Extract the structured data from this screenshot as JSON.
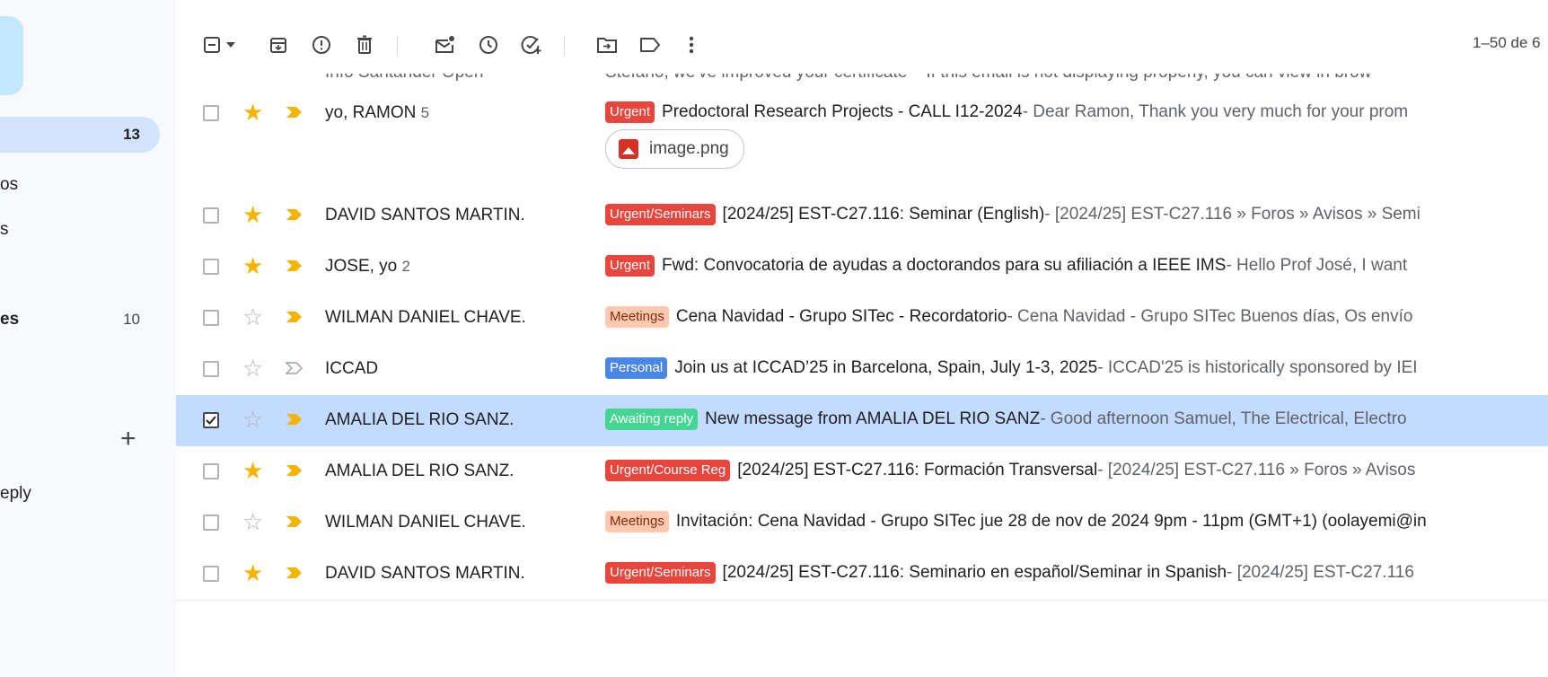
{
  "sidebar": {
    "items": [
      {
        "label": "",
        "count": "13"
      },
      {
        "label": "os",
        "count": ""
      },
      {
        "label": "s",
        "count": ""
      },
      {
        "label": "es",
        "count": "10"
      },
      {
        "label": "eply",
        "count": ""
      }
    ],
    "add_icon": "plus-icon"
  },
  "toolbar": {
    "icons": [
      "select-checkbox-icon",
      "dropdown-arrow-icon",
      "archive-icon",
      "report-spam-icon",
      "delete-icon",
      "mark-unread-icon",
      "snooze-icon",
      "add-task-icon",
      "move-to-icon",
      "label-icon",
      "more-vert-icon"
    ],
    "pager": "1–50 de 6"
  },
  "partial_row": {
    "sender": "Info Santander Open",
    "line": "Stefano, we've improved your certificate – If this email is not displaying properly, you can view in brow"
  },
  "rows": [
    {
      "sender": "yo, RAMON",
      "count": "5",
      "starred": true,
      "important": true,
      "selected": false,
      "label": "Urgent",
      "label_color": "#e8453c",
      "subject": "Predoctoral Research Projects - CALL I12-2024",
      "snippet": " - Dear Ramon, Thank you very much for your prom",
      "attachment": "image.png"
    },
    {
      "sender": "DAVID SANTOS MARTIN.",
      "count": "",
      "starred": true,
      "important": true,
      "selected": false,
      "label": "Urgent/Seminars",
      "label_color": "#e8453c",
      "subject": "[2024/25] EST-C27.116: Seminar (English)",
      "snippet": " - [2024/25] EST-C27.116 » Foros » Avisos » Semi"
    },
    {
      "sender": "JOSE, yo",
      "count": "2",
      "starred": true,
      "important": true,
      "selected": false,
      "label": "Urgent",
      "label_color": "#e8453c",
      "subject": "Fwd: Convocatoria de ayudas a doctorandos para su afiliación a IEEE IMS",
      "snippet": " - Hello Prof José, I want"
    },
    {
      "sender": "WILMAN DANIEL CHAVE.",
      "count": "",
      "starred": false,
      "important": true,
      "selected": false,
      "label": "Meetings",
      "label_color": "#ffc8af",
      "subject": "Cena Navidad - Grupo SITec - Recordatorio",
      "snippet": " - Cena Navidad - Grupo SITec Buenos días, Os envío"
    },
    {
      "sender": "ICCAD",
      "count": "",
      "starred": false,
      "important": false,
      "selected": false,
      "label": "Personal",
      "label_color": "#4a86e8",
      "subject": "Join us at ICCAD’25 in Barcelona, Spain, July 1-3, 2025",
      "snippet": " - ICCAD'25 is historically sponsored by IEI"
    },
    {
      "sender": "AMALIA DEL RIO SANZ.",
      "count": "",
      "starred": false,
      "important": true,
      "selected": true,
      "label": "Awaiting reply",
      "label_color": "#43d692",
      "subject": "New message from AMALIA DEL RIO SANZ",
      "snippet": " - Good afternoon Samuel, The Electrical, Electro"
    },
    {
      "sender": "AMALIA DEL RIO SANZ.",
      "count": "",
      "starred": true,
      "important": true,
      "selected": false,
      "label": "Urgent/Course Reg",
      "label_color": "#e8453c",
      "subject": "[2024/25] EST-C27.116: Formación Transversal",
      "snippet": " - [2024/25] EST-C27.116 » Foros » Avisos"
    },
    {
      "sender": "WILMAN DANIEL CHAVE.",
      "count": "",
      "starred": false,
      "important": true,
      "selected": false,
      "label": "Meetings",
      "label_color": "#ffc8af",
      "subject": "Invitación: Cena Navidad - Grupo SITec jue 28 de nov de 2024 9pm - 11pm (GMT+1) (oolayemi@in",
      "snippet": ""
    },
    {
      "sender": "DAVID SANTOS MARTIN.",
      "count": "",
      "starred": true,
      "important": true,
      "selected": false,
      "label": "Urgent/Seminars",
      "label_color": "#e8453c",
      "subject": "[2024/25] EST-C27.116: Seminario en español/Seminar in Spanish",
      "snippet": " - [2024/25] EST-C27.116"
    }
  ]
}
